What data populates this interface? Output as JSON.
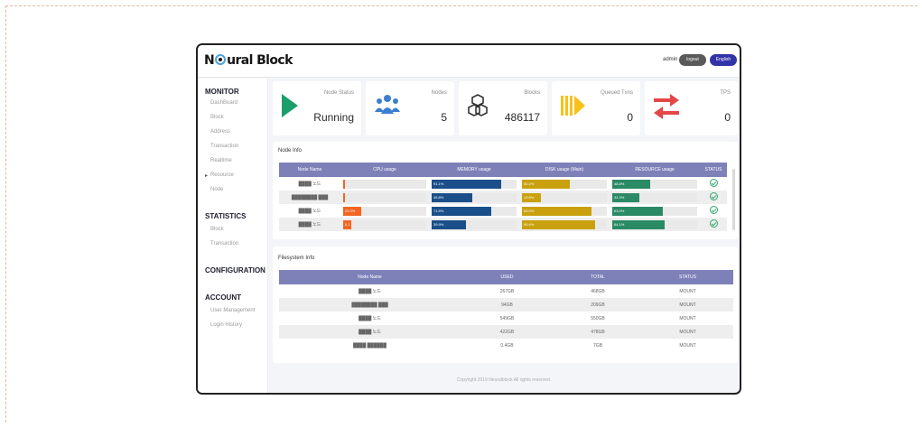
{
  "app": {
    "logo_text_left": "N",
    "logo_text_right": "ural Block"
  },
  "header": {
    "user": "admin",
    "logout_label": "logout",
    "lang_label": "English"
  },
  "sidebar": {
    "monitor": {
      "title": "MONITOR",
      "items": [
        "DashBoard",
        "Block",
        "Address",
        "Transaction",
        "Realtime",
        "Resource",
        "Node"
      ]
    },
    "statistics": {
      "title": "STATISTICS",
      "items": [
        "Block",
        "Transaction"
      ]
    },
    "configuration": {
      "title": "CONFIGURATION"
    },
    "account": {
      "title": "ACCOUNT",
      "items": [
        "User Management",
        "Login History"
      ]
    }
  },
  "cards": [
    {
      "label": "Node Status",
      "value": "Running",
      "icon": "play-icon"
    },
    {
      "label": "Nodes",
      "value": "5",
      "icon": "users-icon"
    },
    {
      "label": "Blocks",
      "value": "486117",
      "icon": "cubes-icon"
    },
    {
      "label": "Queued Txns",
      "value": "0",
      "icon": "queue-icon"
    },
    {
      "label": "TPS",
      "value": "0",
      "icon": "transfer-icon"
    }
  ],
  "node_info": {
    "title": "Node Info",
    "columns": [
      "Node Name",
      "CPU usage",
      "MEMORY usage",
      "DISK usage (Main)",
      "RESOURCE usage",
      "STATUS"
    ],
    "rows": [
      {
        "name": "████ 노드",
        "cpu": 2,
        "cpu_label": "",
        "mem": 82,
        "mem_label": "91.1%",
        "disk": 56,
        "disk_label": "50.2%",
        "res": 45,
        "res_label": "48.8%"
      },
      {
        "name": "████████ ███",
        "cpu": 2,
        "cpu_label": "",
        "mem": 48,
        "mem_label": "45.8%",
        "disk": 22,
        "disk_label": "19.8%",
        "res": 32,
        "res_label": "34.3%"
      },
      {
        "name": "████ 노드",
        "cpu": 22,
        "cpu_label": "22.3%",
        "mem": 70,
        "mem_label": "71.5%",
        "disk": 82,
        "disk_label": "83.0%",
        "res": 60,
        "res_label": "63.0%"
      },
      {
        "name": "████ 노드",
        "cpu": 10,
        "cpu_label": "6.1",
        "mem": 40,
        "mem_label": "39.9%",
        "disk": 86,
        "disk_label": "90.4%",
        "res": 62,
        "res_label": "64.1%"
      }
    ],
    "colors": {
      "cpu": "#f26522",
      "mem": "#1b4f8a",
      "disk": "#c9a10e",
      "res": "#2a8a66",
      "track": "#e9e9e9"
    }
  },
  "fs_info": {
    "title": "Filesystem Info",
    "columns": [
      "Node Name",
      "USED",
      "TOTAL",
      "STATUS"
    ],
    "rows": [
      {
        "name": "████ 노드",
        "used": "267GB",
        "total": "468GB",
        "status": "MOUNT"
      },
      {
        "name": "████████ ███",
        "used": "94GB",
        "total": "209GB",
        "status": "MOUNT"
      },
      {
        "name": "████ 노드",
        "used": "549GB",
        "total": "550GB",
        "status": "MOUNT"
      },
      {
        "name": "████ 노드",
        "used": "422GB",
        "total": "478GB",
        "status": "MOUNT"
      },
      {
        "name": "████ ██████",
        "used": "0.4GB",
        "total": "7GB",
        "status": "MOUNT"
      }
    ]
  },
  "footer": {
    "text": "Copyright 2019 Neuralblock All rights reserved."
  }
}
